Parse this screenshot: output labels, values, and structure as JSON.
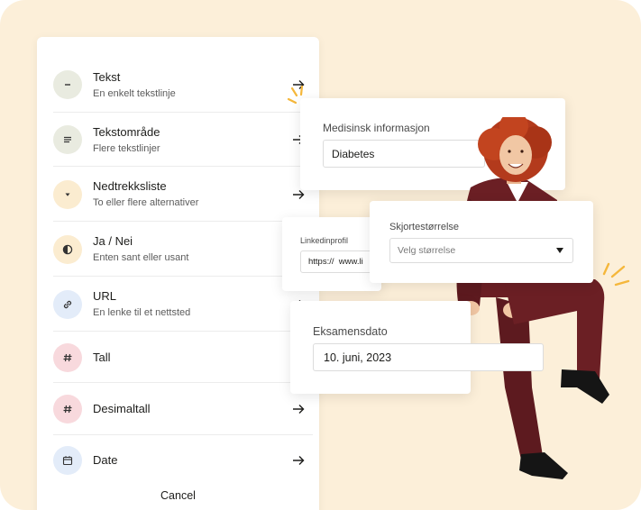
{
  "list": {
    "items": [
      {
        "title": "Tekst",
        "subtitle": "En enkelt tekstlinje",
        "icon": "minus-icon",
        "icon_bg": "#e9ebe0"
      },
      {
        "title": "Tekstområde",
        "subtitle": "Flere tekstlinjer",
        "icon": "lines-icon",
        "icon_bg": "#e9ebe0"
      },
      {
        "title": "Nedtrekksliste",
        "subtitle": "To eller flere alternativer",
        "icon": "caret-down-icon",
        "icon_bg": "#fbecd0"
      },
      {
        "title": "Ja / Nei",
        "subtitle": "Enten sant eller usant",
        "icon": "half-circle-icon",
        "icon_bg": "#fbecd0"
      },
      {
        "title": "URL",
        "subtitle": "En lenke til et nettsted",
        "icon": "link-icon",
        "icon_bg": "#e3ecf9"
      },
      {
        "title": "Tall",
        "subtitle": "",
        "icon": "hash-icon",
        "icon_bg": "#f8d9dd"
      },
      {
        "title": "Desimaltall",
        "subtitle": "",
        "icon": "hash-icon",
        "icon_bg": "#f8d9dd"
      },
      {
        "title": "Date",
        "subtitle": "",
        "icon": "calendar-icon",
        "icon_bg": "#e3ecf9"
      }
    ],
    "cancel_label": "Cancel"
  },
  "medical": {
    "label": "Medisinsk informasjon",
    "value": "Diabetes"
  },
  "linkedin": {
    "label": "Linkedinprofil",
    "value": "https://  www.li"
  },
  "shirt": {
    "label": "Skjortestørrelse",
    "placeholder": "Velg størrelse"
  },
  "exam": {
    "label": "Eksamensdato",
    "value": "10. juni, 2023"
  },
  "colors": {
    "background": "#fcefd9",
    "accent": "#f5b73b",
    "suit": "#6b1f24"
  }
}
